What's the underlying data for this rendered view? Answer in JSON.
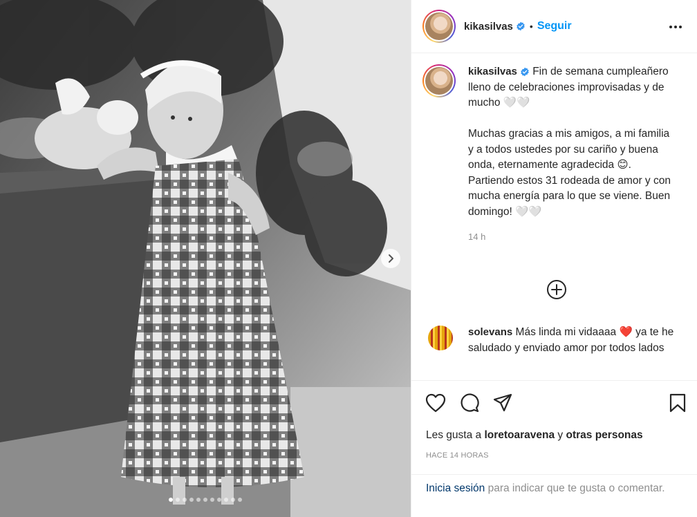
{
  "post": {
    "username": "kikasilvas",
    "follow_label": "Seguir",
    "separator": "•",
    "carousel": {
      "total_slides": 11,
      "current_slide": 1
    }
  },
  "caption": {
    "username": "kikasilvas",
    "line1": "Fin de semana cumpleañero lleno de celebraciones improvisadas y de mucho 🤍🤍",
    "line2a": "Muchas gracias a mis amigos, a mi familia y a todos ustedes por su cariño y buena onda, eternamente agradecida 😊.",
    "line2b": "Partiendo estos 31 rodeada de amor y con mucha energía para lo que se viene. Buen domingo! 🤍🤍",
    "time": "14 h"
  },
  "comment": {
    "username": "solevans",
    "text_a": "Más linda mi vidaaaa ",
    "heart": "❤️",
    "text_b": " ya te he saludado y enviado amor por todos lados"
  },
  "actions": {
    "likes_prefix": "Les gusta a ",
    "likes_user": "loretoaravena",
    "likes_and": " y ",
    "likes_others": "otras personas",
    "time_ago": "HACE 14 HORAS"
  },
  "login_prompt": {
    "link": "Inicia sesión",
    "text": " para indicar que te gusta o comentar."
  },
  "icons": {
    "header_more": "more-horizontal-icon",
    "verified": "verified-badge-icon",
    "add": "plus-circle-icon",
    "like": "heart-icon",
    "comment": "comment-icon",
    "share": "send-icon",
    "save": "bookmark-icon",
    "next": "chevron-right-icon"
  },
  "colors": {
    "link_blue": "#0095f6",
    "verified_blue": "#3897f0",
    "login_link": "#00376b",
    "muted": "#8e8e8e"
  }
}
